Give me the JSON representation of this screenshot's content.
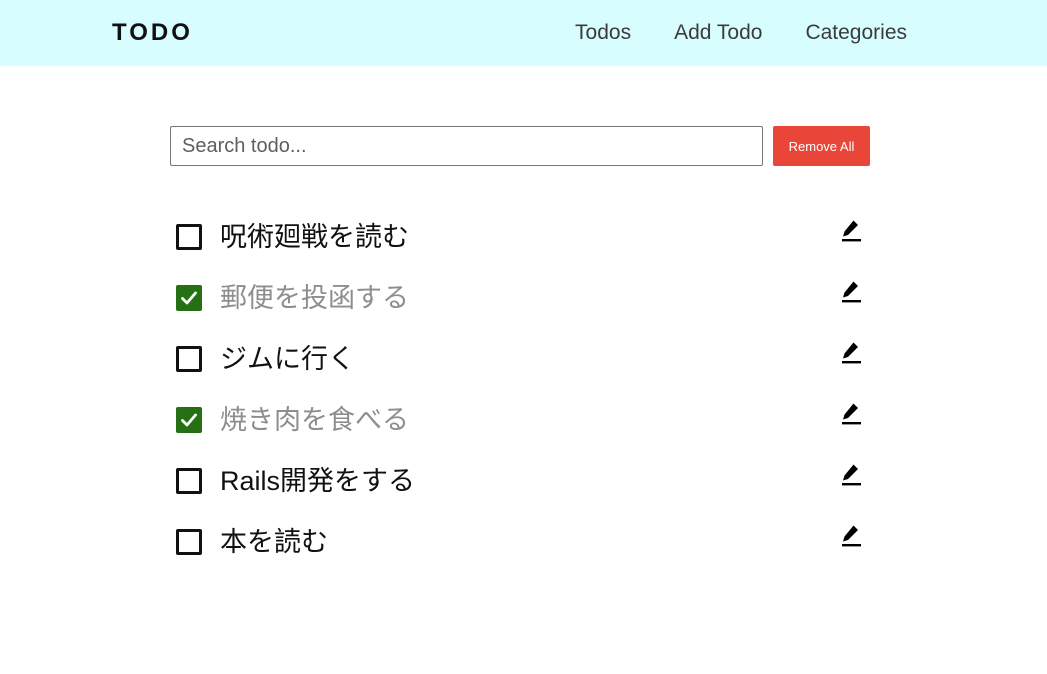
{
  "navbar": {
    "brand": "TODO",
    "links": [
      {
        "label": "Todos"
      },
      {
        "label": "Add Todo"
      },
      {
        "label": "Categories"
      }
    ]
  },
  "search": {
    "value": "",
    "placeholder": "Search todo...",
    "remove_all_label": "Remove All"
  },
  "colors": {
    "navbar_bg": "#d8fdfe",
    "remove_button_bg": "#e94539",
    "checked_bg": "#257012",
    "done_text": "#8e8e8e"
  },
  "todos": [
    {
      "text": "呪術廻戦を読む",
      "done": false,
      "edit_icon": "pencil-icon"
    },
    {
      "text": "郵便を投函する",
      "done": true,
      "edit_icon": "pencil-icon"
    },
    {
      "text": "ジムに行く",
      "done": false,
      "edit_icon": "pencil-icon"
    },
    {
      "text": "焼き肉を食べる",
      "done": true,
      "edit_icon": "pencil-icon"
    },
    {
      "text": "Rails開発をする",
      "done": false,
      "edit_icon": "pencil-icon"
    },
    {
      "text": "本を読む",
      "done": false,
      "edit_icon": "pencil-icon"
    }
  ]
}
